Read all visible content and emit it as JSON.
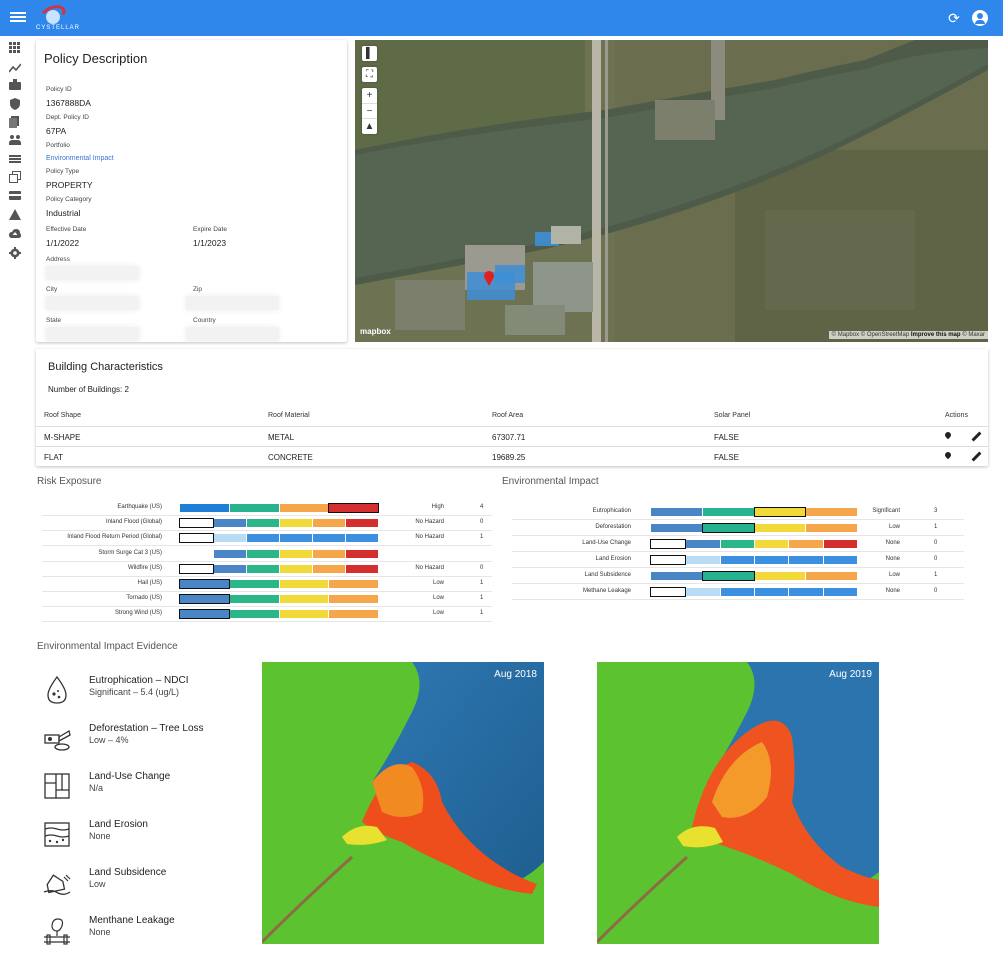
{
  "app": {
    "logo_text": "CYSTELLAR"
  },
  "rail": {
    "icons": [
      "grid-icon",
      "trend-icon",
      "briefcase-icon",
      "shield-icon",
      "documents-icon",
      "people-icon",
      "list-icon",
      "layers-icon",
      "card-icon",
      "warning-icon",
      "cloud-upload-icon",
      "settings-icon"
    ]
  },
  "policy": {
    "title": "Policy Description",
    "policy_id_label": "Policy ID",
    "policy_id": "1367888DA",
    "dept_id_label": "Dept. Policy ID",
    "dept_id": "67PA",
    "portfolio_label": "Portfolio",
    "portfolio": "Environmental Impact",
    "type_label": "Policy Type",
    "type": "PROPERTY",
    "category_label": "Policy Category",
    "category": "Industrial",
    "effective_label": "Effective Date",
    "effective": "1/1/2022",
    "expire_label": "Expire Date",
    "expire": "1/1/2023",
    "address_label": "Address",
    "city_label": "City",
    "zip_label": "Zip",
    "state_label": "State",
    "country_label": "Country"
  },
  "map": {
    "zoom_in": "+",
    "zoom_out": "−",
    "compass": "▲",
    "fullscreen": "⛶",
    "logo": "mapbox",
    "attrib_a": "© Mapbox © OpenStreetMap ",
    "attrib_b": "Improve this map",
    "attrib_c": " © Maxar"
  },
  "building": {
    "title": "Building Characteristics",
    "count": "Number of Buildings: 2",
    "headers": [
      "Roof Shape",
      "Roof Material",
      "Roof Area",
      "Solar Panel",
      "Actions"
    ],
    "rows": [
      [
        "M-SHAPE",
        "METAL",
        "67307.71",
        "FALSE"
      ],
      [
        "FLAT",
        "CONCRETE",
        "19689.25",
        "FALSE"
      ]
    ]
  },
  "risk": {
    "title": "Risk Exposure",
    "rows": [
      {
        "label": "Earthquake (US)",
        "level": "High",
        "value": "4"
      },
      {
        "label": "Inland Flood (Global)",
        "level": "No Hazard",
        "value": "0"
      },
      {
        "label": "Inland Flood Return Period (Global)",
        "level": "No Hazard",
        "value": "1"
      },
      {
        "label": "Storm Surge Cat 3 (US)",
        "level": "",
        "value": ""
      },
      {
        "label": "Wildfire (US)",
        "level": "No Hazard",
        "value": "0"
      },
      {
        "label": "Hail (US)",
        "level": "Low",
        "value": "1"
      },
      {
        "label": "Tornado (US)",
        "level": "Low",
        "value": "1"
      },
      {
        "label": "Strong Wind (US)",
        "level": "Low",
        "value": "1"
      }
    ]
  },
  "impact": {
    "title": "Environmental Impact",
    "rows": [
      {
        "label": "Eutrophication",
        "level": "Significant",
        "value": "3"
      },
      {
        "label": "Deforestation",
        "level": "Low",
        "value": "1"
      },
      {
        "label": "Land-Use Change",
        "level": "None",
        "value": "0"
      },
      {
        "label": "Land Erosion",
        "level": "None",
        "value": "0"
      },
      {
        "label": "Land Subsidence",
        "level": "Low",
        "value": "1"
      },
      {
        "label": "Methane Leakage",
        "level": "None",
        "value": "0"
      }
    ]
  },
  "colors": {
    "white": "#ffffff",
    "lightblue": "#b9dcf5",
    "blue": "#4a86c5",
    "skyblue": "#3d8fe0",
    "green": "#2bb68a",
    "yellow": "#f2d93a",
    "orange": "#f5a64a",
    "red": "#d42f2f",
    "teal": "#27b38f",
    "brightblue": "#1f7fd6"
  },
  "evidence": {
    "title": "Environmental Impact Evidence",
    "items": [
      {
        "title": "Eutrophication – NDCI",
        "sub": "Significant – 5.4 (ug/L)",
        "icon": "water-drop-icon"
      },
      {
        "title": "Deforestation – Tree Loss",
        "sub": "Low – 4%",
        "icon": "chainsaw-icon"
      },
      {
        "title": "Land-Use Change",
        "sub": "N/a",
        "icon": "parcel-map-icon"
      },
      {
        "title": "Land Erosion",
        "sub": "None",
        "icon": "soil-layers-icon"
      },
      {
        "title": "Land Subsidence",
        "sub": "Low",
        "icon": "sinking-house-icon"
      },
      {
        "title": "Menthane Leakage",
        "sub": "None",
        "icon": "pipe-leak-icon"
      }
    ],
    "images": [
      {
        "date": "Aug 2018"
      },
      {
        "date": "Aug 2019"
      }
    ]
  }
}
